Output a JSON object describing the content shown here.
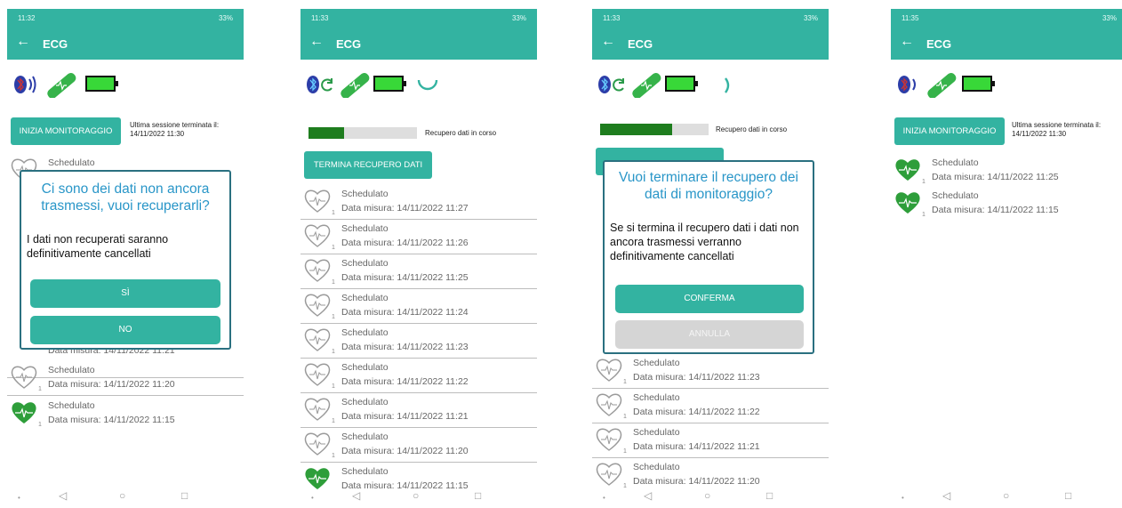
{
  "screens": [
    {
      "status_time": "11:32",
      "status_right": "33%",
      "app_title": "ECG",
      "start_button": "INIZIA MONITORAGGIO",
      "session_line1": "Ultima sessione terminata il:",
      "session_line2": "14/11/2022 11:30",
      "items": [
        {
          "label": "Schedulato",
          "date": "",
          "sub": ""
        },
        {
          "label": "",
          "date": "",
          "sub": ""
        },
        {
          "label": "",
          "date": "",
          "sub": ""
        },
        {
          "label": "",
          "date": "",
          "sub": ""
        },
        {
          "label": "",
          "date": "",
          "sub": ""
        },
        {
          "label": "",
          "date": "Data misura: 14/11/2022 11:21",
          "sub": "1"
        },
        {
          "label": "Schedulato",
          "date": "Data misura: 14/11/2022 11:20",
          "sub": "1"
        },
        {
          "label": "Schedulato",
          "date": "Data misura: 14/11/2022 11:15",
          "sub": "1"
        }
      ],
      "dialog": {
        "title": "Ci sono dei dati non ancora trasmessi, vuoi recuperarli?",
        "message": "I dati non recuperati saranno definitivamente cancellati",
        "confirm": "SÌ",
        "cancel": "NO"
      }
    },
    {
      "status_time": "11:33",
      "status_right": "33%",
      "app_title": "ECG",
      "progress_label": "Recupero dati in corso",
      "progress": 0.33,
      "stop_button": "TERMINA RECUPERO DATI",
      "items": [
        {
          "label": "Schedulato",
          "date": "Data misura: 14/11/2022 11:27",
          "sub": "1"
        },
        {
          "label": "Schedulato",
          "date": "Data misura: 14/11/2022 11:26",
          "sub": "1"
        },
        {
          "label": "Schedulato",
          "date": "Data misura: 14/11/2022 11:25",
          "sub": "1"
        },
        {
          "label": "Schedulato",
          "date": "Data misura: 14/11/2022 11:24",
          "sub": "1"
        },
        {
          "label": "Schedulato",
          "date": "Data misura: 14/11/2022 11:23",
          "sub": "1"
        },
        {
          "label": "Schedulato",
          "date": "Data misura: 14/11/2022 11:22",
          "sub": "1"
        },
        {
          "label": "Schedulato",
          "date": "Data misura: 14/11/2022 11:21",
          "sub": "1"
        },
        {
          "label": "Schedulato",
          "date": "Data misura: 14/11/2022 11:20",
          "sub": "1"
        },
        {
          "label": "Schedulato",
          "date": "Data misura: 14/11/2022 11:15",
          "sub": ""
        }
      ]
    },
    {
      "status_time": "11:33",
      "status_right": "33%",
      "app_title": "ECG",
      "progress_label": "Recupero dati in corso",
      "progress": 0.66,
      "items": [
        {
          "label": "Schedulato",
          "date": "Data misura: 14/11/2022 11:23",
          "sub": "1"
        },
        {
          "label": "Schedulato",
          "date": "Data misura: 14/11/2022 11:22",
          "sub": "1"
        },
        {
          "label": "Schedulato",
          "date": "Data misura: 14/11/2022 11:21",
          "sub": "1"
        },
        {
          "label": "Schedulato",
          "date": "Data misura: 14/11/2022 11:20",
          "sub": "1"
        }
      ],
      "dialog": {
        "title": "Vuoi terminare il recupero dei dati di monitoraggio?",
        "message": "Se si termina il recupero dati i dati non ancora trasmessi verranno definitivamente cancellati",
        "confirm": "CONFERMA",
        "cancel": "ANNULLA"
      }
    },
    {
      "status_time": "11:35",
      "status_right": "33%",
      "app_title": "ECG",
      "start_button": "INIZIA MONITORAGGIO",
      "session_line1": "Ultima sessione terminata il:",
      "session_line2": "14/11/2022 11:30",
      "items": [
        {
          "label": "Schedulato",
          "date": "Data misura: 14/11/2022 11:25",
          "sub": "1"
        },
        {
          "label": "Schedulato",
          "date": "Data misura: 14/11/2022 11:15",
          "sub": "1"
        }
      ]
    }
  ],
  "icons": {
    "bluetooth": "bluetooth-icon",
    "sync": "sync-icon",
    "patch": "ecg-patch-icon",
    "battery": "battery-icon",
    "heart_outline": "heart-outline-icon",
    "heart_filled": "heart-filled-icon",
    "back": "back-arrow-icon"
  },
  "colors": {
    "primary": "#33b3a1",
    "dialog_title": "#2996c8",
    "heart": "#2e9e3a",
    "battery": "#38d838",
    "progress": "#1e7d1e"
  },
  "nav": {
    "back": "◁",
    "home": "○",
    "recents": "□"
  }
}
